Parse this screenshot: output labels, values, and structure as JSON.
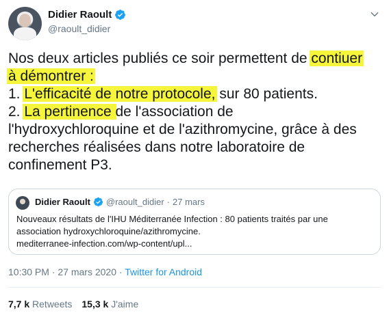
{
  "author": {
    "name": "Didier Raoult",
    "handle": "@raoult_didier"
  },
  "tweet_lines": [
    {
      "before": "Nos deux articles publiés ce soir permettent de ",
      "highlight": "contiuer",
      "after": ""
    },
    {
      "before": "",
      "highlight": "à démontrer :",
      "after": ""
    },
    {
      "before": "1. ",
      "highlight": "L'efficacité de notre protocole,",
      "after": " sur 80 patients."
    },
    {
      "before": "2. ",
      "highlight": "La pertinence ",
      "after": "de l'association de"
    },
    {
      "before": "l'hydroxychloroquine et de l'azithromycine, grâce à des",
      "highlight": "",
      "after": ""
    },
    {
      "before": "recherches réalisées dans notre laboratoire de",
      "highlight": "",
      "after": ""
    },
    {
      "before": "confinement P3.",
      "highlight": "",
      "after": ""
    }
  ],
  "quote": {
    "name": "Didier Raoult",
    "handle": "@raoult_didier",
    "dot": "·",
    "date": "27 mars",
    "lines": [
      "Nouveaux résultats de l'IHU Méditerranée Infection : 80 patients traités par une",
      "association hydroxychloroquine/azithromycine.",
      "mediterranee-infection.com/wp-content/upl..."
    ]
  },
  "meta": {
    "time": "10:30 PM",
    "dot": "·",
    "date": "27 mars 2020",
    "source": "Twitter for Android"
  },
  "stats": {
    "retweets_count": "7,7 k",
    "retweets_label": "Retweets",
    "likes_count": "15,3 k",
    "likes_label": "J'aime"
  },
  "colors": {
    "verified": "#1da1f2",
    "highlight": "#f5f53c",
    "link": "#1b95e0",
    "muted": "#657786"
  },
  "icons": {
    "verified": "verified-badge-icon",
    "menu": "chevron-down-icon"
  }
}
